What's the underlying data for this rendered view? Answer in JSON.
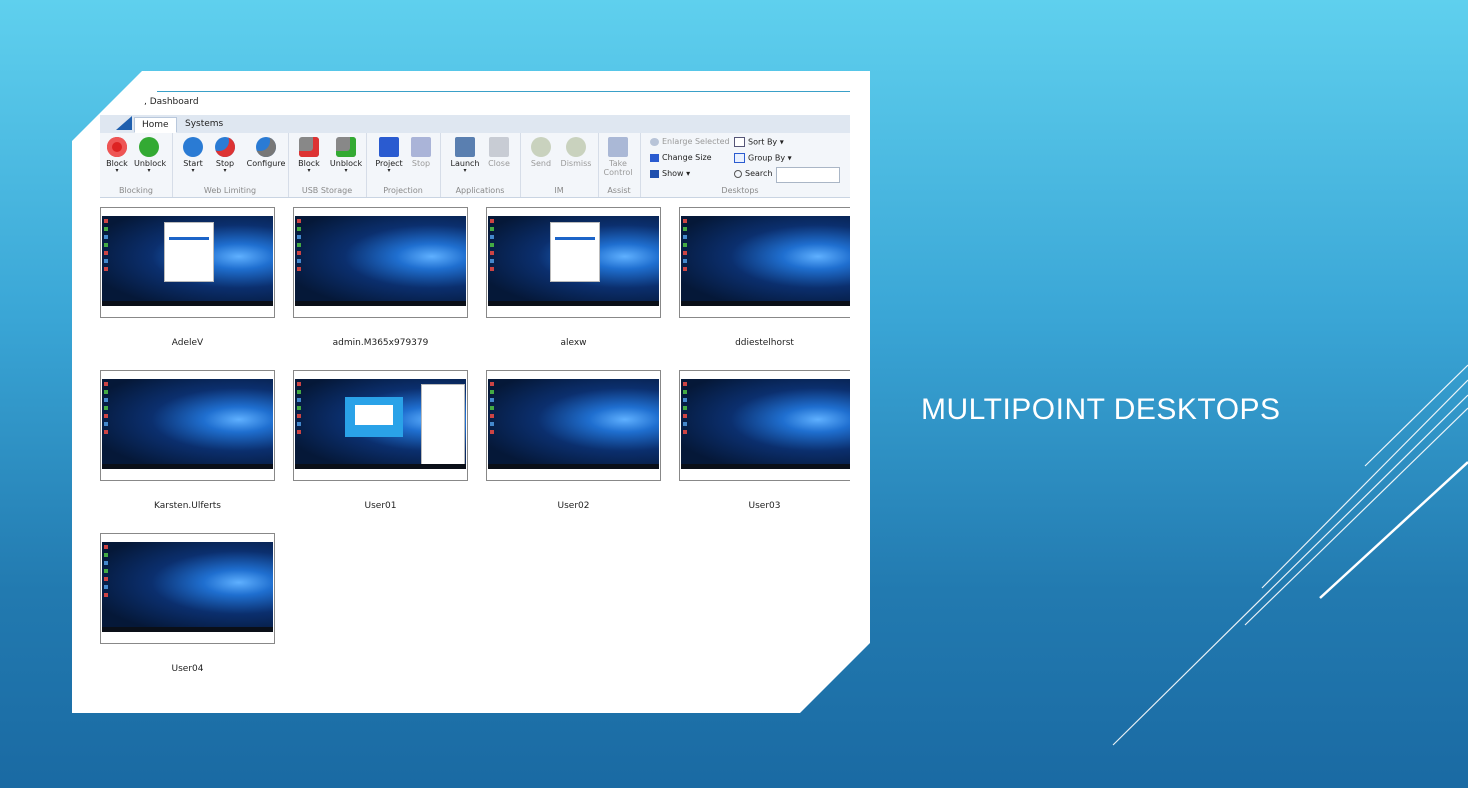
{
  "slide": {
    "title": "MULTIPOINT DESKTOPS"
  },
  "window": {
    "breadcrumb": ", Dashboard"
  },
  "tabs": [
    {
      "label": "Home",
      "active": true
    },
    {
      "label": "Systems",
      "active": false
    }
  ],
  "ribbon": {
    "blocking": {
      "label": "Blocking",
      "block": "Block",
      "unblock": "Unblock"
    },
    "web_limiting": {
      "label": "Web Limiting",
      "start": "Start",
      "stop": "Stop",
      "configure": "Configure"
    },
    "usb_storage": {
      "label": "USB Storage",
      "block": "Block",
      "unblock": "Unblock"
    },
    "projection": {
      "label": "Projection",
      "project": "Project",
      "stop": "Stop"
    },
    "applications": {
      "label": "Applications",
      "launch": "Launch",
      "close": "Close"
    },
    "im": {
      "label": "IM",
      "send": "Send",
      "dismiss": "Dismiss"
    },
    "assist": {
      "label": "Assist",
      "take_control_1": "Take",
      "take_control_2": "Control"
    },
    "desktops": {
      "label": "Desktops",
      "enlarge_selected": "Enlarge Selected",
      "change_size": "Change Size",
      "show": "Show",
      "sort_by": "Sort By",
      "group_by": "Group By",
      "search": "Search",
      "search_value": ""
    }
  },
  "desktops": [
    {
      "label": "AdeleV",
      "variant": "dialog"
    },
    {
      "label": "admin.M365x979379",
      "variant": "plain"
    },
    {
      "label": "alexw",
      "variant": "dialog"
    },
    {
      "label": "ddiestelhorst",
      "variant": "plain"
    },
    {
      "label": "Karsten.Ulferts",
      "variant": "plain"
    },
    {
      "label": "User01",
      "variant": "signin"
    },
    {
      "label": "User02",
      "variant": "plain"
    },
    {
      "label": "User03",
      "variant": "plain"
    },
    {
      "label": "User04",
      "variant": "plain"
    }
  ],
  "colors": {
    "accent": "#1f5fae",
    "slide_bg_top": "#5fd0ee",
    "slide_bg_bottom": "#1a6aa3"
  }
}
